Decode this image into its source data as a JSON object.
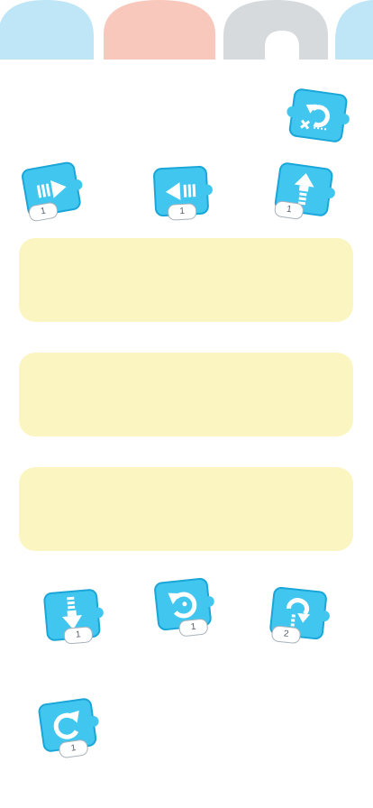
{
  "colors": {
    "block_fill": "#41c6ef",
    "block_border": "#1aa6d8",
    "drop_zone": "#fbf6c1",
    "arch_blue": "#bfe6f6",
    "arch_pink": "#f8c8bd",
    "arch_gray": "#d6dadd"
  },
  "top_blocks": [
    {
      "icon": "move-right-icon",
      "count": "1"
    },
    {
      "icon": "move-left-icon",
      "count": "1"
    },
    {
      "icon": "move-up-icon",
      "count": "1"
    }
  ],
  "bottom_blocks": [
    {
      "icon": "move-down-icon",
      "count": "1"
    },
    {
      "icon": "rotate-counterclockwise-icon",
      "count": "1"
    },
    {
      "icon": "jump-icon",
      "count": "2"
    },
    {
      "icon": "rotate-clockwise-icon",
      "count": "1"
    }
  ],
  "reset_block": {
    "icon": "reset-icon"
  }
}
